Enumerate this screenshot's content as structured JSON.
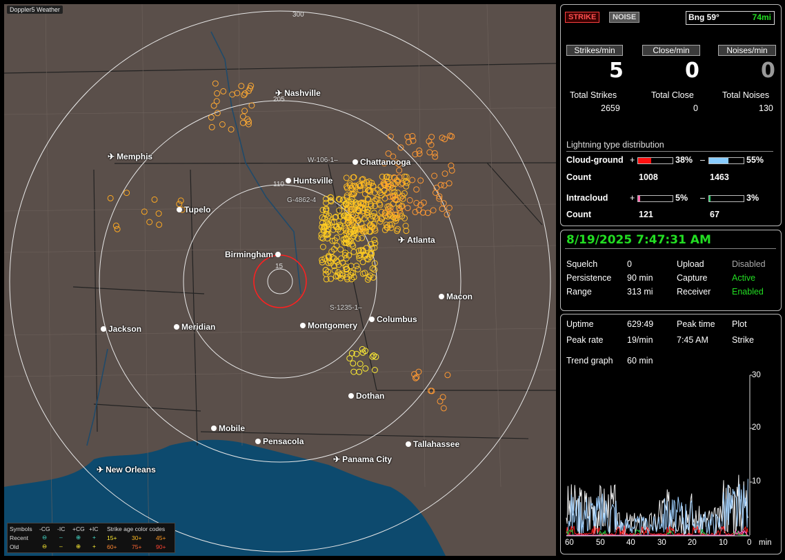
{
  "map": {
    "corner_tag": "Doppler5 Weather",
    "rings": [
      {
        "label": "300"
      },
      {
        "label": "205"
      },
      {
        "label": "110"
      },
      {
        "label": "15"
      }
    ],
    "cities": [
      {
        "name": "Nashville",
        "icon": "airport-icon"
      },
      {
        "name": "Memphis",
        "icon": "airport-icon"
      },
      {
        "name": "Chattanooga",
        "icon": "city-dot-icon"
      },
      {
        "name": "Huntsville",
        "icon": "city-dot-icon"
      },
      {
        "name": "Tupelo",
        "icon": "city-dot-icon"
      },
      {
        "name": "Atlanta",
        "icon": "airport-icon"
      },
      {
        "name": "Birmingham",
        "icon": "city-dot-icon"
      },
      {
        "name": "Macon",
        "icon": "city-dot-icon"
      },
      {
        "name": "Jackson",
        "icon": "city-dot-icon"
      },
      {
        "name": "Meridian",
        "icon": "city-dot-icon"
      },
      {
        "name": "Montgomery",
        "icon": "city-dot-icon"
      },
      {
        "name": "Columbus",
        "icon": "city-dot-icon"
      },
      {
        "name": "Dothan",
        "icon": "city-dot-icon"
      },
      {
        "name": "Mobile",
        "icon": "city-dot-icon"
      },
      {
        "name": "Pensacola",
        "icon": "city-dot-icon"
      },
      {
        "name": "Tallahassee",
        "icon": "city-dot-icon"
      },
      {
        "name": "Panama City",
        "icon": "airport-icon"
      },
      {
        "name": "New Orleans",
        "icon": "airport-icon"
      }
    ],
    "markers": [
      "W-106-1–",
      "G-4862-4",
      "S-1235-1–"
    ],
    "legend": {
      "symbols_label": "Symbols",
      "cols": [
        "-CG",
        "-IC",
        "+CG",
        "+IC"
      ],
      "recent": "Recent",
      "old": "Old",
      "age_title": "Strike age color codes",
      "ages_recent": [
        "15+",
        "30+",
        "45+"
      ],
      "ages_old": [
        "60+",
        "75+",
        "90+"
      ]
    }
  },
  "top_panel": {
    "strike_btn": "STRIKE",
    "noise_btn": "NOISE",
    "bearing": "Bng 59°",
    "distance": "74mi",
    "labels": [
      "Strikes/min",
      "Close/min",
      "Noises/min"
    ],
    "values": [
      "5",
      "0",
      "0"
    ],
    "totals_labels": [
      "Total Strikes",
      "Total Close",
      "Total Noises"
    ],
    "totals_values": [
      "2659",
      "0",
      "130"
    ],
    "dist_title": "Lightning type distribution",
    "cg_label": "Cloud-ground",
    "ic_label": "Intracloud",
    "count_label": "Count",
    "plus": "+",
    "minus": "–",
    "cg_pos_pct": "38%",
    "cg_neg_pct": "55%",
    "cg_pos_count": "1008",
    "cg_neg_count": "1463",
    "ic_pos_pct": "5%",
    "ic_neg_pct": "3%",
    "ic_pos_count": "121",
    "ic_neg_count": "67",
    "fills": {
      "cg_pos": 0.38,
      "cg_neg": 0.55,
      "ic_pos": 0.05,
      "ic_neg": 0.03
    }
  },
  "status_panel": {
    "datetime": "8/19/2025 7:47:31 AM",
    "rows": [
      {
        "k1": "Squelch",
        "v1": "0",
        "k2": "Upload",
        "v2": "Disabled"
      },
      {
        "k1": "Persistence",
        "v1": "90 min",
        "k2": "Capture",
        "v2": "Active"
      },
      {
        "k1": "Range",
        "v1": "313 mi",
        "k2": "Receiver",
        "v2": "Enabled"
      }
    ]
  },
  "trend_panel": {
    "uptime_label": "Uptime",
    "uptime": "629:49",
    "peak_time_label": "Peak time",
    "peak_time": "7:45 AM",
    "plot_label": "Plot",
    "plot_value": "Strike",
    "peak_rate_label": "Peak rate",
    "peak_rate": "19/min",
    "trend_label": "Trend graph",
    "trend_value": "60 min",
    "y_ticks": [
      "30",
      "20",
      "10"
    ],
    "x_ticks": [
      "60",
      "50",
      "40",
      "30",
      "20",
      "10",
      "0"
    ],
    "x_unit": "min"
  },
  "colors": {
    "strike_red": "#ff2020",
    "green": "#22dd22",
    "cg_pos": "#ff1010",
    "cg_neg": "#88ccff",
    "ic_pos": "#ff66aa",
    "ic_neg": "#22cc66",
    "map_land": "#5a4f4a",
    "water": "#0d4a6e"
  }
}
